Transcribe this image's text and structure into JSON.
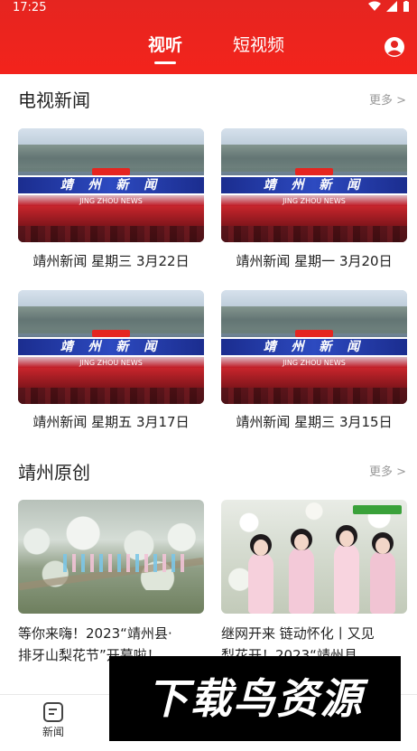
{
  "status": {
    "time": "17:25",
    "icons": [
      "wifi-icon",
      "signal-icon",
      "battery-icon"
    ]
  },
  "header": {
    "tabs": [
      {
        "label": "视听",
        "active": true
      },
      {
        "label": "短视频",
        "active": false
      }
    ],
    "avatar_icon": "account-circle-icon",
    "color": "#e52520"
  },
  "sections": {
    "tv_news": {
      "title": "电视新闻",
      "more": "更多 >",
      "items": [
        {
          "caption": "靖州新闻 星期三 3月22日",
          "thumb_title": "靖 州 新 闻",
          "thumb_sub": "JING ZHOU NEWS"
        },
        {
          "caption": "靖州新闻 星期一 3月20日",
          "thumb_title": "靖 州 新 闻",
          "thumb_sub": "JING ZHOU NEWS"
        },
        {
          "caption": "靖州新闻 星期五 3月17日",
          "thumb_title": "靖 州 新 闻",
          "thumb_sub": "JING ZHOU NEWS"
        },
        {
          "caption": "靖州新闻 星期三 3月15日",
          "thumb_title": "靖 州 新 闻",
          "thumb_sub": "JING ZHOU NEWS"
        }
      ]
    },
    "original": {
      "title": "靖州原创",
      "more": "更多 >",
      "items": [
        {
          "line1": "等你来嗨！2023“靖州县·",
          "line2": "排牙山梨花节”开幕啦！"
        },
        {
          "line1": "继网开来 链动怀化丨又见",
          "line2": "梨花开！2023“靖州县..."
        }
      ]
    }
  },
  "tabbar": {
    "items": [
      {
        "label": "新闻",
        "icon": "news-icon"
      }
    ]
  },
  "watermark": {
    "text": "下载鸟资源"
  }
}
